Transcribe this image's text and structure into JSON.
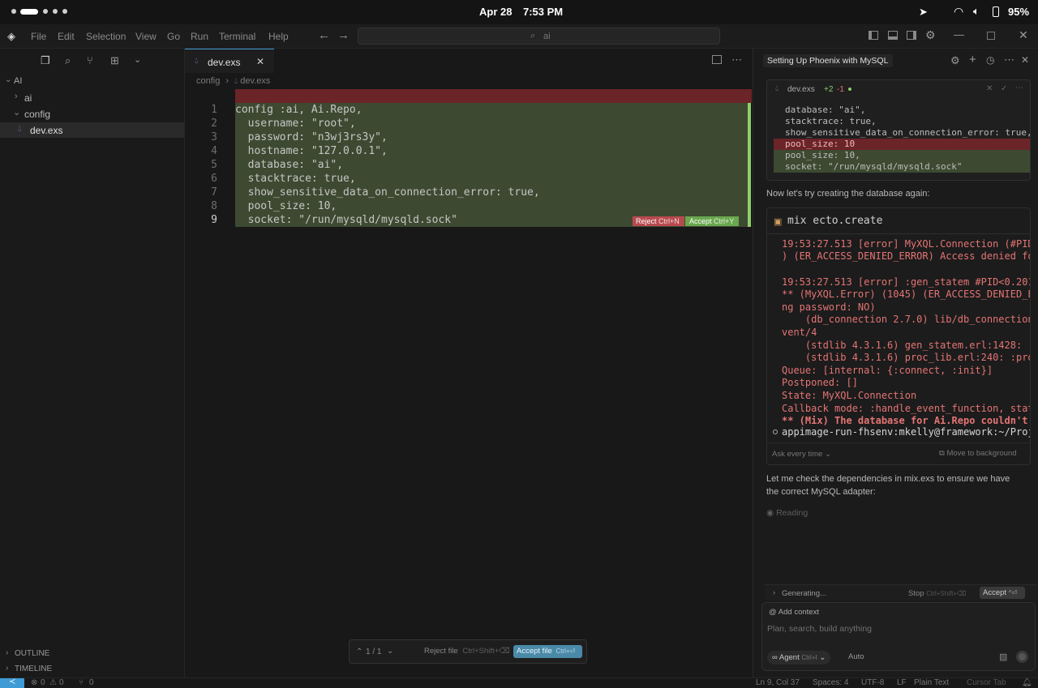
{
  "system": {
    "date": "Apr 28",
    "time": "7:53 PM",
    "battery": "95%"
  },
  "menu": [
    "File",
    "Edit",
    "Selection",
    "View",
    "Go",
    "Run",
    "Terminal",
    "Help"
  ],
  "search": {
    "placeholder": "ai"
  },
  "explorer": {
    "root": "AI",
    "items": [
      {
        "label": "ai"
      },
      {
        "label": "config"
      },
      {
        "label": "dev.exs"
      }
    ],
    "outline": "OUTLINE",
    "timeline": "TIMELINE"
  },
  "editor": {
    "tab": "dev.exs",
    "breadcrumb": [
      "config",
      "dev.exs"
    ],
    "lines": [
      {
        "n": "1",
        "text": "config :ai, Ai.Repo,"
      },
      {
        "n": "2",
        "text": "  username: \"root\","
      },
      {
        "n": "3",
        "text": "  password: \"n3wj3rs3y\","
      },
      {
        "n": "4",
        "text": "  hostname: \"127.0.0.1\","
      },
      {
        "n": "5",
        "text": "  database: \"ai\","
      },
      {
        "n": "6",
        "text": "  stacktrace: true,"
      },
      {
        "n": "7",
        "text": "  show_sensitive_data_on_connection_error: true,"
      },
      {
        "n": "8",
        "text": "  pool_size: 10,"
      },
      {
        "n": "9",
        "text": "  socket: \"/run/mysqld/mysqld.sock\""
      }
    ],
    "reject_label": "Reject",
    "reject_shortcut": "Ctrl+N",
    "accept_label": "Accept",
    "accept_shortcut": "Ctrl+Y",
    "review": {
      "counter": "1 / 1",
      "reject_file": "Reject file",
      "reject_file_shortcut": "Ctrl+Shift+⌫",
      "accept_file": "Accept file",
      "accept_file_shortcut": "Ctrl+⏎"
    }
  },
  "chat": {
    "title": "Setting Up Phoenix with MySQL",
    "diff_card": {
      "file": "dev.exs",
      "added": "+2",
      "removed": "-1",
      "lines": [
        {
          "kind": "ctx",
          "text": "database: \"ai\","
        },
        {
          "kind": "ctx",
          "text": "stacktrace: true,"
        },
        {
          "kind": "ctx",
          "text": "show_sensitive_data_on_connection_error: true,"
        },
        {
          "kind": "del",
          "text": "pool_size: 10"
        },
        {
          "kind": "add",
          "text": "pool_size: 10,"
        },
        {
          "kind": "add",
          "text": "socket: \"/run/mysqld/mysqld.sock\""
        }
      ]
    },
    "message1": "Now let's try creating the database again:",
    "terminal": {
      "command": "mix ecto.create",
      "lines": [
        "19:53:27.513 [error] MyXQL.Connection (#PID",
        ") (ER_ACCESS_DENIED_ERROR) Access denied fo",
        "",
        "19:53:27.513 [error] :gen_statem #PID<0.201",
        "** (MyXQL.Error) (1045) (ER_ACCESS_DENIED_E",
        "ng password: NO)",
        "    (db_connection 2.7.0) lib/db_connection",
        "vent/4",
        "    (stdlib 4.3.1.6) gen_statem.erl:1428: :",
        "    (stdlib 4.3.1.6) proc_lib.erl:240: :pro",
        "Queue: [internal: {:connect, :init}]",
        "Postponed: []",
        "State: MyXQL.Connection",
        "Callback mode: :handle_event_function, stat",
        "** (Mix) The database for Ai.Repo couldn't"
      ],
      "prompt": "appimage-run-fhsenv:mkelly@framework:~/Proj",
      "ask_label": "Ask every time",
      "move_label": "Move to background"
    },
    "message2": "Let me check the dependencies in mix.exs to ensure we have the correct MySQL adapter:",
    "reading": "Reading",
    "generating": "Generating...",
    "stop": "Stop",
    "stop_shortcut": "Ctrl+Shift+⌫",
    "accept": "Accept",
    "accept_shortcut": "^⏎",
    "add_context": "Add context",
    "input_placeholder": "Plan, search, build anything",
    "agent_label": "Agent",
    "agent_shortcut": "Ctrl+I",
    "auto_label": "Auto"
  },
  "statusbar": {
    "errors": "0",
    "warnings": "0",
    "ports": "0",
    "position": "Ln 9, Col 37",
    "spaces": "Spaces: 4",
    "encoding": "UTF-8",
    "eol": "LF",
    "language": "Plain Text",
    "cursor_tab": "Cursor Tab"
  },
  "colors": {
    "accent": "#3e9bd6",
    "diff_add": "#3d4a31",
    "diff_del": "#6b2428",
    "error_text": "#e57474"
  }
}
